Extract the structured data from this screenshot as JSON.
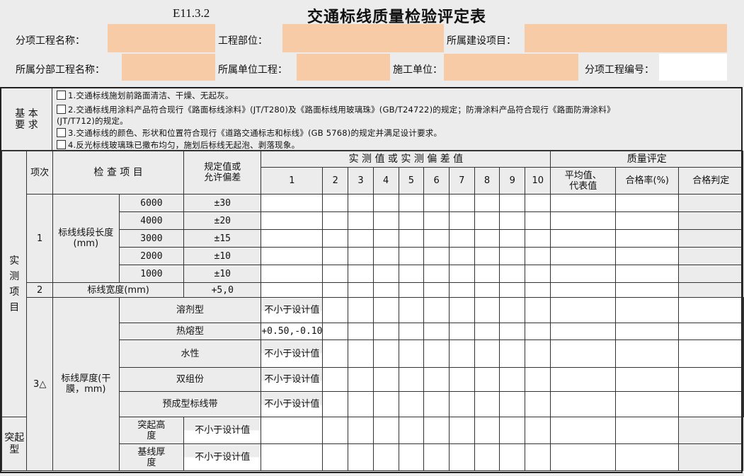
{
  "header": {
    "code": "E11.3.2",
    "title": "交通标线质量检验评定表"
  },
  "info": {
    "sub_item_name": "分项工程名称：",
    "project_part": "工程部位：",
    "construction_project": "所属建设项目：",
    "division_name": "所属分部工程名称：",
    "unit_project": "所属单位工程：",
    "contractor": "施工单位：",
    "sub_item_no": "分项工程编号："
  },
  "basic": {
    "label": "基 本\n要 求",
    "items": [
      "1.交通标线施划前路面清洁、干燥、无起灰。",
      "2.交通标线用涂料产品符合现行《路面标线涂料》(JT/T280)及《路面标线用玻璃珠》(GB/T24722)的规定；防滑涂料产品符合现行《路面防滑涂料》",
      "(JT/T712)的规定。",
      "3.交通标线的颜色、形状和位置符合现行《道路交通标志和标线》(GB 5768)的规定并满足设计要求。",
      "4.反光标线玻璃珠已撒布均匀，施划后标线无起泡、剥落现象。"
    ]
  },
  "table": {
    "measured_label": "实\n测\n项\n目",
    "col_item_no": "项次",
    "col_check_item": "检 查 项 目",
    "col_spec": "规定值或\n允许偏差",
    "col_measured": "实 测 值 或 实 测 偏 差 值",
    "measure_nums": [
      "1",
      "2",
      "3",
      "4",
      "5",
      "6",
      "7",
      "8",
      "9",
      "10"
    ],
    "col_quality": "质量评定",
    "col_avg": "平均值、\n代表值",
    "col_rate": "合格率(%)",
    "col_judge": "合格判定",
    "item1": {
      "no": "1",
      "name": "标线线段长度\n(mm)",
      "rows": [
        {
          "sub": "6000",
          "spec": "±30"
        },
        {
          "sub": "4000",
          "spec": "±20"
        },
        {
          "sub": "3000",
          "spec": "±15"
        },
        {
          "sub": "2000",
          "spec": "±10"
        },
        {
          "sub": "1000",
          "spec": "±10"
        }
      ]
    },
    "item2": {
      "no": "2",
      "name": "标线宽度(mm)",
      "spec": "+5,0"
    },
    "item3": {
      "no": "3△",
      "name": "标线厚度(干\n膜，mm)",
      "rows": [
        {
          "sub": "溶剂型",
          "spec": "不小于设计值"
        },
        {
          "sub": "热熔型",
          "spec": "+0.50,-0.10"
        },
        {
          "sub": "水性",
          "spec": "不小于设计值"
        },
        {
          "sub": "双组份",
          "spec": "不小于设计值"
        },
        {
          "sub": "预成型标线带",
          "spec": "不小于设计值"
        }
      ],
      "raised": {
        "label": "突起\n型",
        "rows": [
          {
            "sub": "突起高\n度",
            "spec": "不小于设计值"
          },
          {
            "sub": "基线厚\n度",
            "spec": "不小于设计值"
          }
        ]
      }
    }
  }
}
